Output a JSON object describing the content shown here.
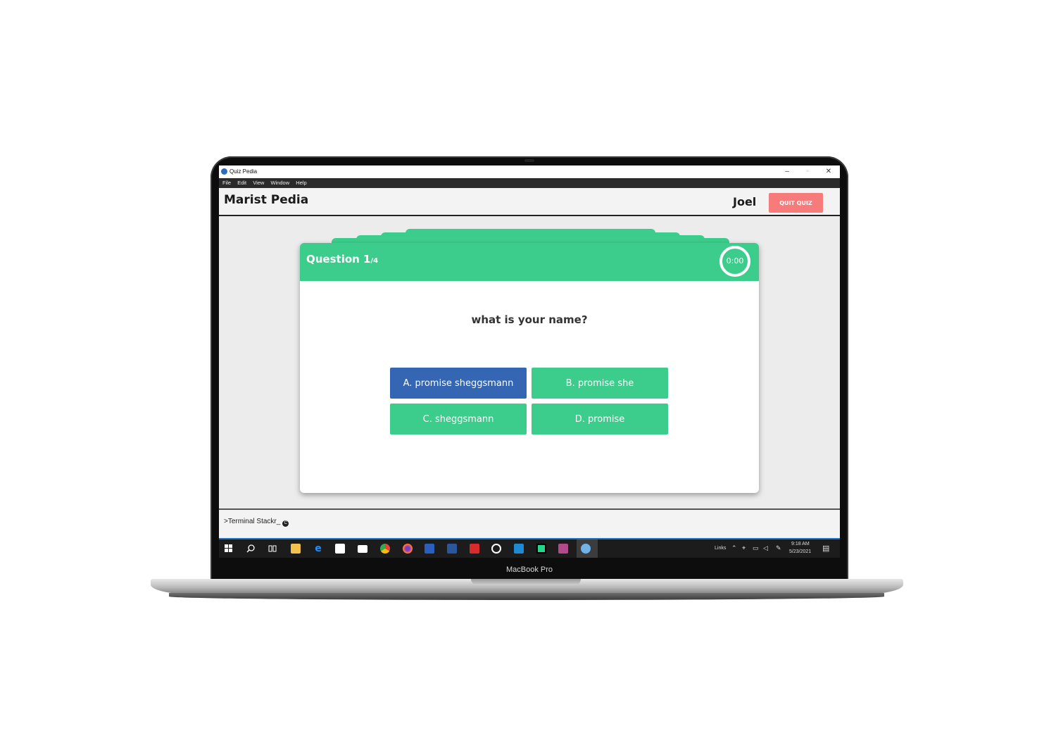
{
  "device": {
    "brand_label": "MacBook Pro"
  },
  "window": {
    "title": "Quiz Pedia",
    "controls": {
      "minimize": "–",
      "maximize": "▫",
      "close": "✕"
    },
    "menu": [
      "File",
      "Edit",
      "View",
      "Window",
      "Help"
    ]
  },
  "header": {
    "brand": "Marist Pedia",
    "user": "Joel",
    "quit_label": "QUIT QUIZ"
  },
  "quiz": {
    "question_label": "Question 1",
    "question_total": "/4",
    "timer": "0:00",
    "question": "what is your name?",
    "answers": [
      {
        "label": "A. promise sheggsmann",
        "selected": true
      },
      {
        "label": "B. promise she",
        "selected": false
      },
      {
        "label": "C. sheggsmann",
        "selected": false
      },
      {
        "label": "D. promise",
        "selected": false
      }
    ]
  },
  "footer": {
    "terminal_text": ">Terminal Stackr_",
    "icon_letter": "C"
  },
  "taskbar": {
    "tray_links": "Links",
    "time": "9:18 AM",
    "date": "5/23/2021",
    "icons": [
      "start-icon",
      "search-icon",
      "task-view-icon",
      "file-explorer-icon",
      "edge-icon",
      "store-icon",
      "mail-icon",
      "chrome-icon",
      "firefox-icon",
      "app-icon",
      "word-icon",
      "acrobat-icon",
      "media-icon",
      "vscode-icon",
      "pycharm-icon",
      "winrar-icon",
      "quiz-pedia-icon"
    ]
  },
  "colors": {
    "accent_green": "#3ccd8c",
    "selected_blue": "#3466b4",
    "quit_red": "#f77b7b"
  }
}
